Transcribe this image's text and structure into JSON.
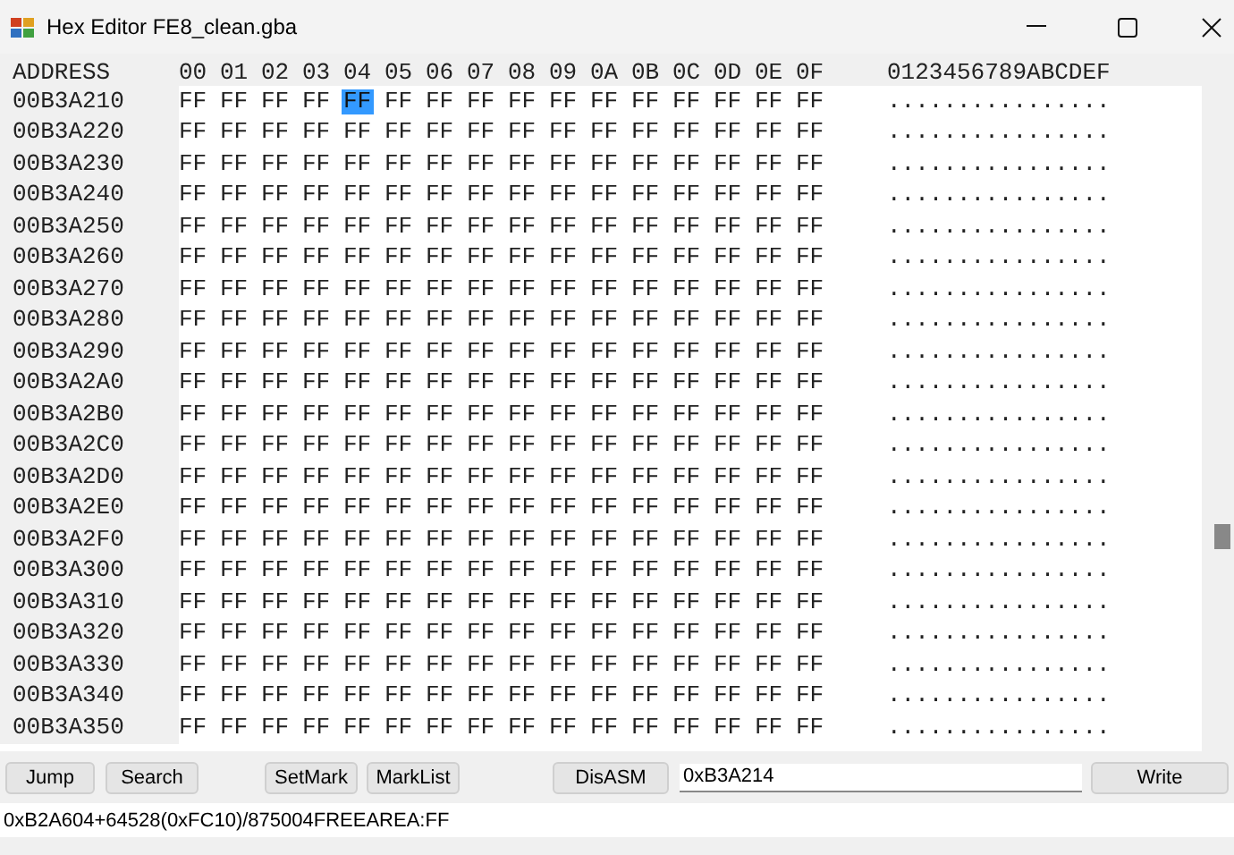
{
  "window": {
    "title": "Hex Editor FE8_clean.gba"
  },
  "grid": {
    "header": {
      "address": "ADDRESS",
      "columns": [
        "00",
        "01",
        "02",
        "03",
        "04",
        "05",
        "06",
        "07",
        "08",
        "09",
        "0A",
        "0B",
        "0C",
        "0D",
        "0E",
        "0F"
      ],
      "ascii": "0123456789ABCDEF"
    },
    "rows": [
      {
        "address": "00B3A210",
        "ascii": "................",
        "cells": [
          {
            "text": "FF",
            "selected": false
          },
          {
            "text": "FF",
            "selected": false
          },
          {
            "text": "FF",
            "selected": false
          },
          {
            "text": "FF",
            "selected": false
          },
          {
            "text": "FF",
            "selected": true
          },
          {
            "text": "FF",
            "selected": false
          },
          {
            "text": "FF",
            "selected": false
          },
          {
            "text": "FF",
            "selected": false
          },
          {
            "text": "FF",
            "selected": false
          },
          {
            "text": "FF",
            "selected": false
          },
          {
            "text": "FF",
            "selected": false
          },
          {
            "text": "FF",
            "selected": false
          },
          {
            "text": "FF",
            "selected": false
          },
          {
            "text": "FF",
            "selected": false
          },
          {
            "text": "FF",
            "selected": false
          },
          {
            "text": "FF",
            "selected": false
          }
        ]
      },
      {
        "address": "00B3A220",
        "ascii": "................",
        "cells": [
          {
            "text": "FF",
            "selected": false
          },
          {
            "text": "FF",
            "selected": false
          },
          {
            "text": "FF",
            "selected": false
          },
          {
            "text": "FF",
            "selected": false
          },
          {
            "text": "FF",
            "selected": false
          },
          {
            "text": "FF",
            "selected": false
          },
          {
            "text": "FF",
            "selected": false
          },
          {
            "text": "FF",
            "selected": false
          },
          {
            "text": "FF",
            "selected": false
          },
          {
            "text": "FF",
            "selected": false
          },
          {
            "text": "FF",
            "selected": false
          },
          {
            "text": "FF",
            "selected": false
          },
          {
            "text": "FF",
            "selected": false
          },
          {
            "text": "FF",
            "selected": false
          },
          {
            "text": "FF",
            "selected": false
          },
          {
            "text": "FF",
            "selected": false
          }
        ]
      },
      {
        "address": "00B3A230",
        "ascii": "................",
        "cells": [
          {
            "text": "FF",
            "selected": false
          },
          {
            "text": "FF",
            "selected": false
          },
          {
            "text": "FF",
            "selected": false
          },
          {
            "text": "FF",
            "selected": false
          },
          {
            "text": "FF",
            "selected": false
          },
          {
            "text": "FF",
            "selected": false
          },
          {
            "text": "FF",
            "selected": false
          },
          {
            "text": "FF",
            "selected": false
          },
          {
            "text": "FF",
            "selected": false
          },
          {
            "text": "FF",
            "selected": false
          },
          {
            "text": "FF",
            "selected": false
          },
          {
            "text": "FF",
            "selected": false
          },
          {
            "text": "FF",
            "selected": false
          },
          {
            "text": "FF",
            "selected": false
          },
          {
            "text": "FF",
            "selected": false
          },
          {
            "text": "FF",
            "selected": false
          }
        ]
      },
      {
        "address": "00B3A240",
        "ascii": "................",
        "cells": [
          {
            "text": "FF",
            "selected": false
          },
          {
            "text": "FF",
            "selected": false
          },
          {
            "text": "FF",
            "selected": false
          },
          {
            "text": "FF",
            "selected": false
          },
          {
            "text": "FF",
            "selected": false
          },
          {
            "text": "FF",
            "selected": false
          },
          {
            "text": "FF",
            "selected": false
          },
          {
            "text": "FF",
            "selected": false
          },
          {
            "text": "FF",
            "selected": false
          },
          {
            "text": "FF",
            "selected": false
          },
          {
            "text": "FF",
            "selected": false
          },
          {
            "text": "FF",
            "selected": false
          },
          {
            "text": "FF",
            "selected": false
          },
          {
            "text": "FF",
            "selected": false
          },
          {
            "text": "FF",
            "selected": false
          },
          {
            "text": "FF",
            "selected": false
          }
        ]
      },
      {
        "address": "00B3A250",
        "ascii": "................",
        "cells": [
          {
            "text": "FF",
            "selected": false
          },
          {
            "text": "FF",
            "selected": false
          },
          {
            "text": "FF",
            "selected": false
          },
          {
            "text": "FF",
            "selected": false
          },
          {
            "text": "FF",
            "selected": false
          },
          {
            "text": "FF",
            "selected": false
          },
          {
            "text": "FF",
            "selected": false
          },
          {
            "text": "FF",
            "selected": false
          },
          {
            "text": "FF",
            "selected": false
          },
          {
            "text": "FF",
            "selected": false
          },
          {
            "text": "FF",
            "selected": false
          },
          {
            "text": "FF",
            "selected": false
          },
          {
            "text": "FF",
            "selected": false
          },
          {
            "text": "FF",
            "selected": false
          },
          {
            "text": "FF",
            "selected": false
          },
          {
            "text": "FF",
            "selected": false
          }
        ]
      },
      {
        "address": "00B3A260",
        "ascii": "................",
        "cells": [
          {
            "text": "FF",
            "selected": false
          },
          {
            "text": "FF",
            "selected": false
          },
          {
            "text": "FF",
            "selected": false
          },
          {
            "text": "FF",
            "selected": false
          },
          {
            "text": "FF",
            "selected": false
          },
          {
            "text": "FF",
            "selected": false
          },
          {
            "text": "FF",
            "selected": false
          },
          {
            "text": "FF",
            "selected": false
          },
          {
            "text": "FF",
            "selected": false
          },
          {
            "text": "FF",
            "selected": false
          },
          {
            "text": "FF",
            "selected": false
          },
          {
            "text": "FF",
            "selected": false
          },
          {
            "text": "FF",
            "selected": false
          },
          {
            "text": "FF",
            "selected": false
          },
          {
            "text": "FF",
            "selected": false
          },
          {
            "text": "FF",
            "selected": false
          }
        ]
      },
      {
        "address": "00B3A270",
        "ascii": "................",
        "cells": [
          {
            "text": "FF",
            "selected": false
          },
          {
            "text": "FF",
            "selected": false
          },
          {
            "text": "FF",
            "selected": false
          },
          {
            "text": "FF",
            "selected": false
          },
          {
            "text": "FF",
            "selected": false
          },
          {
            "text": "FF",
            "selected": false
          },
          {
            "text": "FF",
            "selected": false
          },
          {
            "text": "FF",
            "selected": false
          },
          {
            "text": "FF",
            "selected": false
          },
          {
            "text": "FF",
            "selected": false
          },
          {
            "text": "FF",
            "selected": false
          },
          {
            "text": "FF",
            "selected": false
          },
          {
            "text": "FF",
            "selected": false
          },
          {
            "text": "FF",
            "selected": false
          },
          {
            "text": "FF",
            "selected": false
          },
          {
            "text": "FF",
            "selected": false
          }
        ]
      },
      {
        "address": "00B3A280",
        "ascii": "................",
        "cells": [
          {
            "text": "FF",
            "selected": false
          },
          {
            "text": "FF",
            "selected": false
          },
          {
            "text": "FF",
            "selected": false
          },
          {
            "text": "FF",
            "selected": false
          },
          {
            "text": "FF",
            "selected": false
          },
          {
            "text": "FF",
            "selected": false
          },
          {
            "text": "FF",
            "selected": false
          },
          {
            "text": "FF",
            "selected": false
          },
          {
            "text": "FF",
            "selected": false
          },
          {
            "text": "FF",
            "selected": false
          },
          {
            "text": "FF",
            "selected": false
          },
          {
            "text": "FF",
            "selected": false
          },
          {
            "text": "FF",
            "selected": false
          },
          {
            "text": "FF",
            "selected": false
          },
          {
            "text": "FF",
            "selected": false
          },
          {
            "text": "FF",
            "selected": false
          }
        ]
      },
      {
        "address": "00B3A290",
        "ascii": "................",
        "cells": [
          {
            "text": "FF",
            "selected": false
          },
          {
            "text": "FF",
            "selected": false
          },
          {
            "text": "FF",
            "selected": false
          },
          {
            "text": "FF",
            "selected": false
          },
          {
            "text": "FF",
            "selected": false
          },
          {
            "text": "FF",
            "selected": false
          },
          {
            "text": "FF",
            "selected": false
          },
          {
            "text": "FF",
            "selected": false
          },
          {
            "text": "FF",
            "selected": false
          },
          {
            "text": "FF",
            "selected": false
          },
          {
            "text": "FF",
            "selected": false
          },
          {
            "text": "FF",
            "selected": false
          },
          {
            "text": "FF",
            "selected": false
          },
          {
            "text": "FF",
            "selected": false
          },
          {
            "text": "FF",
            "selected": false
          },
          {
            "text": "FF",
            "selected": false
          }
        ]
      },
      {
        "address": "00B3A2A0",
        "ascii": "................",
        "cells": [
          {
            "text": "FF",
            "selected": false
          },
          {
            "text": "FF",
            "selected": false
          },
          {
            "text": "FF",
            "selected": false
          },
          {
            "text": "FF",
            "selected": false
          },
          {
            "text": "FF",
            "selected": false
          },
          {
            "text": "FF",
            "selected": false
          },
          {
            "text": "FF",
            "selected": false
          },
          {
            "text": "FF",
            "selected": false
          },
          {
            "text": "FF",
            "selected": false
          },
          {
            "text": "FF",
            "selected": false
          },
          {
            "text": "FF",
            "selected": false
          },
          {
            "text": "FF",
            "selected": false
          },
          {
            "text": "FF",
            "selected": false
          },
          {
            "text": "FF",
            "selected": false
          },
          {
            "text": "FF",
            "selected": false
          },
          {
            "text": "FF",
            "selected": false
          }
        ]
      },
      {
        "address": "00B3A2B0",
        "ascii": "................",
        "cells": [
          {
            "text": "FF",
            "selected": false
          },
          {
            "text": "FF",
            "selected": false
          },
          {
            "text": "FF",
            "selected": false
          },
          {
            "text": "FF",
            "selected": false
          },
          {
            "text": "FF",
            "selected": false
          },
          {
            "text": "FF",
            "selected": false
          },
          {
            "text": "FF",
            "selected": false
          },
          {
            "text": "FF",
            "selected": false
          },
          {
            "text": "FF",
            "selected": false
          },
          {
            "text": "FF",
            "selected": false
          },
          {
            "text": "FF",
            "selected": false
          },
          {
            "text": "FF",
            "selected": false
          },
          {
            "text": "FF",
            "selected": false
          },
          {
            "text": "FF",
            "selected": false
          },
          {
            "text": "FF",
            "selected": false
          },
          {
            "text": "FF",
            "selected": false
          }
        ]
      },
      {
        "address": "00B3A2C0",
        "ascii": "................",
        "cells": [
          {
            "text": "FF",
            "selected": false
          },
          {
            "text": "FF",
            "selected": false
          },
          {
            "text": "FF",
            "selected": false
          },
          {
            "text": "FF",
            "selected": false
          },
          {
            "text": "FF",
            "selected": false
          },
          {
            "text": "FF",
            "selected": false
          },
          {
            "text": "FF",
            "selected": false
          },
          {
            "text": "FF",
            "selected": false
          },
          {
            "text": "FF",
            "selected": false
          },
          {
            "text": "FF",
            "selected": false
          },
          {
            "text": "FF",
            "selected": false
          },
          {
            "text": "FF",
            "selected": false
          },
          {
            "text": "FF",
            "selected": false
          },
          {
            "text": "FF",
            "selected": false
          },
          {
            "text": "FF",
            "selected": false
          },
          {
            "text": "FF",
            "selected": false
          }
        ]
      },
      {
        "address": "00B3A2D0",
        "ascii": "................",
        "cells": [
          {
            "text": "FF",
            "selected": false
          },
          {
            "text": "FF",
            "selected": false
          },
          {
            "text": "FF",
            "selected": false
          },
          {
            "text": "FF",
            "selected": false
          },
          {
            "text": "FF",
            "selected": false
          },
          {
            "text": "FF",
            "selected": false
          },
          {
            "text": "FF",
            "selected": false
          },
          {
            "text": "FF",
            "selected": false
          },
          {
            "text": "FF",
            "selected": false
          },
          {
            "text": "FF",
            "selected": false
          },
          {
            "text": "FF",
            "selected": false
          },
          {
            "text": "FF",
            "selected": false
          },
          {
            "text": "FF",
            "selected": false
          },
          {
            "text": "FF",
            "selected": false
          },
          {
            "text": "FF",
            "selected": false
          },
          {
            "text": "FF",
            "selected": false
          }
        ]
      },
      {
        "address": "00B3A2E0",
        "ascii": "................",
        "cells": [
          {
            "text": "FF",
            "selected": false
          },
          {
            "text": "FF",
            "selected": false
          },
          {
            "text": "FF",
            "selected": false
          },
          {
            "text": "FF",
            "selected": false
          },
          {
            "text": "FF",
            "selected": false
          },
          {
            "text": "FF",
            "selected": false
          },
          {
            "text": "FF",
            "selected": false
          },
          {
            "text": "FF",
            "selected": false
          },
          {
            "text": "FF",
            "selected": false
          },
          {
            "text": "FF",
            "selected": false
          },
          {
            "text": "FF",
            "selected": false
          },
          {
            "text": "FF",
            "selected": false
          },
          {
            "text": "FF",
            "selected": false
          },
          {
            "text": "FF",
            "selected": false
          },
          {
            "text": "FF",
            "selected": false
          },
          {
            "text": "FF",
            "selected": false
          }
        ]
      },
      {
        "address": "00B3A2F0",
        "ascii": "................",
        "cells": [
          {
            "text": "FF",
            "selected": false
          },
          {
            "text": "FF",
            "selected": false
          },
          {
            "text": "FF",
            "selected": false
          },
          {
            "text": "FF",
            "selected": false
          },
          {
            "text": "FF",
            "selected": false
          },
          {
            "text": "FF",
            "selected": false
          },
          {
            "text": "FF",
            "selected": false
          },
          {
            "text": "FF",
            "selected": false
          },
          {
            "text": "FF",
            "selected": false
          },
          {
            "text": "FF",
            "selected": false
          },
          {
            "text": "FF",
            "selected": false
          },
          {
            "text": "FF",
            "selected": false
          },
          {
            "text": "FF",
            "selected": false
          },
          {
            "text": "FF",
            "selected": false
          },
          {
            "text": "FF",
            "selected": false
          },
          {
            "text": "FF",
            "selected": false
          }
        ]
      },
      {
        "address": "00B3A300",
        "ascii": "................",
        "cells": [
          {
            "text": "FF",
            "selected": false
          },
          {
            "text": "FF",
            "selected": false
          },
          {
            "text": "FF",
            "selected": false
          },
          {
            "text": "FF",
            "selected": false
          },
          {
            "text": "FF",
            "selected": false
          },
          {
            "text": "FF",
            "selected": false
          },
          {
            "text": "FF",
            "selected": false
          },
          {
            "text": "FF",
            "selected": false
          },
          {
            "text": "FF",
            "selected": false
          },
          {
            "text": "FF",
            "selected": false
          },
          {
            "text": "FF",
            "selected": false
          },
          {
            "text": "FF",
            "selected": false
          },
          {
            "text": "FF",
            "selected": false
          },
          {
            "text": "FF",
            "selected": false
          },
          {
            "text": "FF",
            "selected": false
          },
          {
            "text": "FF",
            "selected": false
          }
        ]
      },
      {
        "address": "00B3A310",
        "ascii": "................",
        "cells": [
          {
            "text": "FF",
            "selected": false
          },
          {
            "text": "FF",
            "selected": false
          },
          {
            "text": "FF",
            "selected": false
          },
          {
            "text": "FF",
            "selected": false
          },
          {
            "text": "FF",
            "selected": false
          },
          {
            "text": "FF",
            "selected": false
          },
          {
            "text": "FF",
            "selected": false
          },
          {
            "text": "FF",
            "selected": false
          },
          {
            "text": "FF",
            "selected": false
          },
          {
            "text": "FF",
            "selected": false
          },
          {
            "text": "FF",
            "selected": false
          },
          {
            "text": "FF",
            "selected": false
          },
          {
            "text": "FF",
            "selected": false
          },
          {
            "text": "FF",
            "selected": false
          },
          {
            "text": "FF",
            "selected": false
          },
          {
            "text": "FF",
            "selected": false
          }
        ]
      },
      {
        "address": "00B3A320",
        "ascii": "................",
        "cells": [
          {
            "text": "FF",
            "selected": false
          },
          {
            "text": "FF",
            "selected": false
          },
          {
            "text": "FF",
            "selected": false
          },
          {
            "text": "FF",
            "selected": false
          },
          {
            "text": "FF",
            "selected": false
          },
          {
            "text": "FF",
            "selected": false
          },
          {
            "text": "FF",
            "selected": false
          },
          {
            "text": "FF",
            "selected": false
          },
          {
            "text": "FF",
            "selected": false
          },
          {
            "text": "FF",
            "selected": false
          },
          {
            "text": "FF",
            "selected": false
          },
          {
            "text": "FF",
            "selected": false
          },
          {
            "text": "FF",
            "selected": false
          },
          {
            "text": "FF",
            "selected": false
          },
          {
            "text": "FF",
            "selected": false
          },
          {
            "text": "FF",
            "selected": false
          }
        ]
      },
      {
        "address": "00B3A330",
        "ascii": "................",
        "cells": [
          {
            "text": "FF",
            "selected": false
          },
          {
            "text": "FF",
            "selected": false
          },
          {
            "text": "FF",
            "selected": false
          },
          {
            "text": "FF",
            "selected": false
          },
          {
            "text": "FF",
            "selected": false
          },
          {
            "text": "FF",
            "selected": false
          },
          {
            "text": "FF",
            "selected": false
          },
          {
            "text": "FF",
            "selected": false
          },
          {
            "text": "FF",
            "selected": false
          },
          {
            "text": "FF",
            "selected": false
          },
          {
            "text": "FF",
            "selected": false
          },
          {
            "text": "FF",
            "selected": false
          },
          {
            "text": "FF",
            "selected": false
          },
          {
            "text": "FF",
            "selected": false
          },
          {
            "text": "FF",
            "selected": false
          },
          {
            "text": "FF",
            "selected": false
          }
        ]
      },
      {
        "address": "00B3A340",
        "ascii": "................",
        "cells": [
          {
            "text": "FF",
            "selected": false
          },
          {
            "text": "FF",
            "selected": false
          },
          {
            "text": "FF",
            "selected": false
          },
          {
            "text": "FF",
            "selected": false
          },
          {
            "text": "FF",
            "selected": false
          },
          {
            "text": "FF",
            "selected": false
          },
          {
            "text": "FF",
            "selected": false
          },
          {
            "text": "FF",
            "selected": false
          },
          {
            "text": "FF",
            "selected": false
          },
          {
            "text": "FF",
            "selected": false
          },
          {
            "text": "FF",
            "selected": false
          },
          {
            "text": "FF",
            "selected": false
          },
          {
            "text": "FF",
            "selected": false
          },
          {
            "text": "FF",
            "selected": false
          },
          {
            "text": "FF",
            "selected": false
          },
          {
            "text": "FF",
            "selected": false
          }
        ]
      },
      {
        "address": "00B3A350",
        "ascii": "................",
        "cells": [
          {
            "text": "FF",
            "selected": false
          },
          {
            "text": "FF",
            "selected": false
          },
          {
            "text": "FF",
            "selected": false
          },
          {
            "text": "FF",
            "selected": false
          },
          {
            "text": "FF",
            "selected": false
          },
          {
            "text": "FF",
            "selected": false
          },
          {
            "text": "FF",
            "selected": false
          },
          {
            "text": "FF",
            "selected": false
          },
          {
            "text": "FF",
            "selected": false
          },
          {
            "text": "FF",
            "selected": false
          },
          {
            "text": "FF",
            "selected": false
          },
          {
            "text": "FF",
            "selected": false
          },
          {
            "text": "FF",
            "selected": false
          },
          {
            "text": "FF",
            "selected": false
          },
          {
            "text": "FF",
            "selected": false
          },
          {
            "text": "FF",
            "selected": false
          }
        ]
      }
    ]
  },
  "toolbar": {
    "buttons": [
      "Jump",
      "Search",
      "SetMark",
      "MarkList",
      "DisASM"
    ],
    "address_field": {
      "value": "0xB3A214"
    },
    "write_button": "Write"
  },
  "status_bar": {
    "value": "0xB2A604+64528(0xFC10)/875004FREEAREA:FF"
  }
}
